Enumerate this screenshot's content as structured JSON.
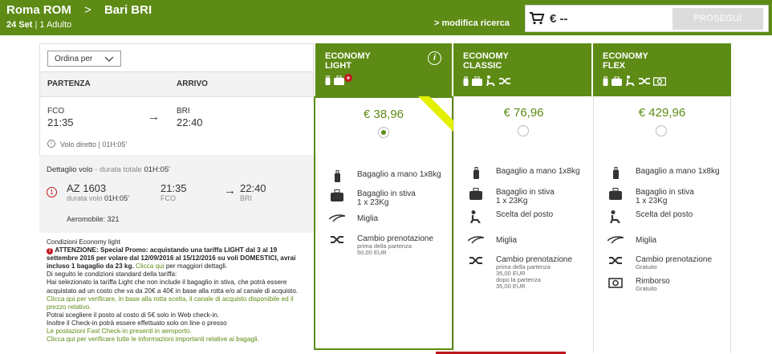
{
  "header": {
    "route_from": "Roma ROM",
    "route_to": "Bari BRI",
    "date": "24 Set",
    "passengers": "| 1 Adulto",
    "modify": "> modifica ricerca",
    "cart_amount": "€ --",
    "continue_label": "PROSEGUI"
  },
  "sort": {
    "label": "Ordina per"
  },
  "columns": {
    "departure": "PARTENZA",
    "arrival": "ARRIVO"
  },
  "flight": {
    "from_code": "FCO",
    "from_time": "21:35",
    "to_code": "BRI",
    "to_time": "22:40",
    "info": "Volo diretto | 01H:05'"
  },
  "detail": {
    "title": "Dettaglio volo",
    "duration_label": "- durata totale",
    "duration": "01H:05'",
    "step": "1",
    "flight_no": "AZ 1603",
    "flight_duration_label": "durata volo",
    "flight_duration": "01H:05'",
    "dep_time": "21:35",
    "dep_code": "FCO",
    "arr_time": "22:40",
    "arr_code": "BRI",
    "aircraft": "Aeromobile: 321"
  },
  "conditions": {
    "title": "Condizioni Economy light",
    "attention": "ATTENZIONE: Special Promo: acquistando una tariffa LIGHT dal 3 al 19 settembre 2016 per volare dal 12/09/2016 al 15/12/2016 su voli DOMESTICI, avrai incluso 1 bagaglio da 23 kg.",
    "clicca": "Clicca qui",
    "attention_tail": "per maggiori dettagli.",
    "l1": "Di seguito le condizioni standard della tariffa:",
    "l2": "Hai selezionato la tariffa Light che non include il bagaglio in stiva, che potrà essere acquistato ad un costo che va da 20€ a 40€ in base alla rotta e/o al canale di acquisto.",
    "l2b": "Clicca qui per verificare, in base alla rotta scelta, il canale di acquisto disponibile ed il prezzo relativo.",
    "l3": "Potrai scegliere il posto al costo di 5€ solo in Web check-in.",
    "l4": "Inoltre il Check-in potrà essere effettuato solo on line o presso",
    "l5": "Le postazioni Fast Check-in presenti in aeroporto.",
    "l6": "Clicca qui per verificare tutte le informazioni importanti relative ai bagagli."
  },
  "fares": [
    {
      "name1": "ECONOMY",
      "name2": "LIGHT",
      "price": "€ 38,96",
      "selected": true,
      "features": [
        {
          "icon": "hand-baggage-icon",
          "t": "Bagaglio a mano 1x8kg"
        },
        {
          "icon": "checked-baggage-icon",
          "t": "Bagaglio in stiva",
          "s": "1 x 23Kg"
        },
        {
          "icon": "miles-icon",
          "t": "Miglia"
        },
        {
          "icon": "change-booking-icon",
          "t": "Cambio prenotazione",
          "s": "prima della partenza",
          "s2": "50,00 EUR"
        }
      ]
    },
    {
      "name1": "ECONOMY",
      "name2": "CLASSIC",
      "price": "€ 76,96",
      "selected": false,
      "features": [
        {
          "icon": "hand-baggage-icon",
          "t": "Bagaglio a mano 1x8kg"
        },
        {
          "icon": "checked-baggage-icon",
          "t": "Bagaglio in stiva",
          "s": "1 x 23Kg"
        },
        {
          "icon": "seat-selection-icon",
          "t": "Scelta del posto"
        },
        {
          "icon": "miles-icon",
          "t": "Miglia"
        },
        {
          "icon": "change-booking-icon",
          "t": "Cambio prenotazione",
          "s": "prima della partenza",
          "s2": "35,00 EUR",
          "s3": "dopo la partenza",
          "s4": "35,00 EUR"
        }
      ]
    },
    {
      "name1": "ECONOMY",
      "name2": "FLEX",
      "price": "€ 429,96",
      "selected": false,
      "features": [
        {
          "icon": "hand-baggage-icon",
          "t": "Bagaglio a mano 1x8kg"
        },
        {
          "icon": "checked-baggage-icon",
          "t": "Bagaglio in stiva",
          "s": "1 x 23Kg"
        },
        {
          "icon": "seat-selection-icon",
          "t": "Scelta del posto"
        },
        {
          "icon": "miles-icon",
          "t": "Miglia"
        },
        {
          "icon": "change-booking-icon",
          "t": "Cambio prenotazione",
          "s": "Gratuito"
        },
        {
          "icon": "refund-icon",
          "t": "Rimborso",
          "s": "Gratuito"
        }
      ]
    }
  ],
  "colors": {
    "brand": "#5d8b15",
    "badge": "#e3f000",
    "alert": "#c0161e"
  }
}
